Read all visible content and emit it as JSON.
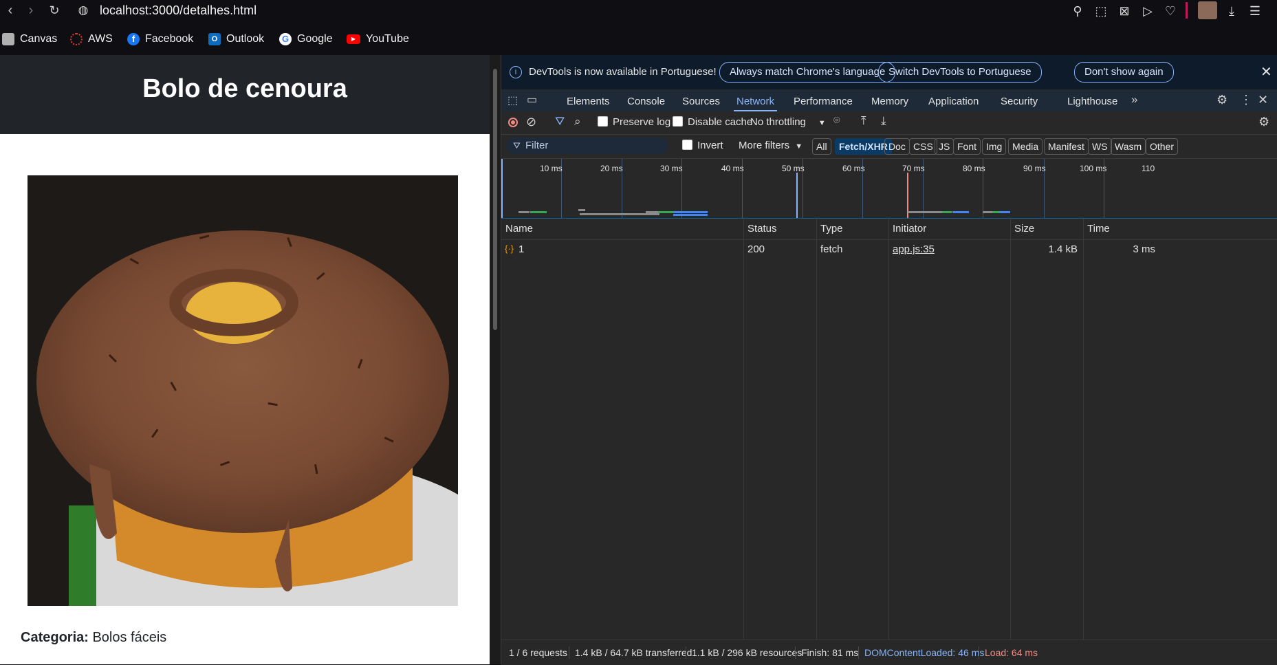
{
  "browser": {
    "url": "localhost:3000/detalhes.html",
    "bookmarks": [
      {
        "label": "Canvas",
        "icon": "canvas-icon",
        "color": "#b0b0b0"
      },
      {
        "label": "AWS",
        "icon": "aws-icon",
        "color": "#e33b2e"
      },
      {
        "label": "Facebook",
        "icon": "facebook-icon",
        "color": "#1877f2"
      },
      {
        "label": "Outlook",
        "icon": "outlook-icon",
        "color": "#0f6cbd"
      },
      {
        "label": "Google",
        "icon": "google-icon",
        "color": "#ffffff"
      },
      {
        "label": "YouTube",
        "icon": "youtube-icon",
        "color": "#ff0000"
      }
    ]
  },
  "page": {
    "title": "Bolo de cenoura",
    "category_label": "Categoria:",
    "category_value": "Bolos fáceis"
  },
  "devtools": {
    "info_message": "DevTools is now available in Portuguese!",
    "info_buttons": [
      "Always match Chrome's language",
      "Switch DevTools to Portuguese",
      "Don't show again"
    ],
    "tabs": [
      "Elements",
      "Console",
      "Sources",
      "Network",
      "Performance",
      "Memory",
      "Application",
      "Security",
      "Lighthouse"
    ],
    "active_tab": "Network",
    "toolbar": {
      "preserve_log": "Preserve log",
      "disable_cache": "Disable cache",
      "throttling": "No throttling"
    },
    "filter": {
      "placeholder": "Filter",
      "invert": "Invert",
      "more_filters": "More filters",
      "chips": [
        "All",
        "Fetch/XHR",
        "Doc",
        "CSS",
        "JS",
        "Font",
        "Img",
        "Media",
        "Manifest",
        "WS",
        "Wasm",
        "Other"
      ],
      "active_chip": "Fetch/XHR"
    },
    "timeline_ticks": [
      "10 ms",
      "20 ms",
      "30 ms",
      "40 ms",
      "50 ms",
      "60 ms",
      "70 ms",
      "80 ms",
      "90 ms",
      "100 ms",
      "110"
    ],
    "table": {
      "columns": [
        "Name",
        "Status",
        "Type",
        "Initiator",
        "Size",
        "Time"
      ],
      "rows": [
        {
          "name": "1",
          "status": "200",
          "type": "fetch",
          "initiator": "app.js:35",
          "size": "1.4 kB",
          "time": "3 ms"
        }
      ]
    },
    "status": {
      "requests": "1 / 6 requests",
      "transferred": "1.4 kB / 64.7 kB transferred",
      "resources": "1.1 kB / 296 kB resources",
      "finish": "Finish: 81 ms",
      "dom_loaded": "DOMContentLoaded: 46 ms",
      "load": "Load: 64 ms",
      "dom_color": "#8ab4f8",
      "load_color": "#f28b82"
    }
  }
}
